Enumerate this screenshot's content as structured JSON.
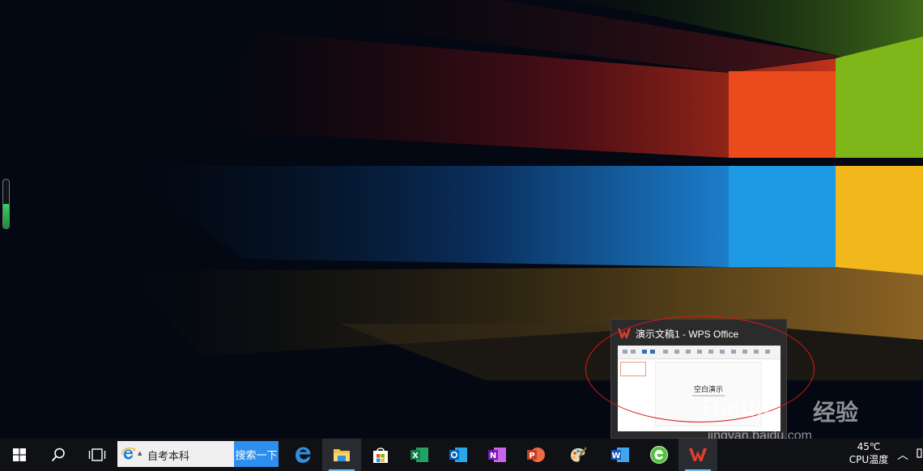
{
  "preview": {
    "title": "演示文稿1 - WPS Office",
    "canvas_title": "空白演示"
  },
  "taskbar": {
    "search_text": "自考本科",
    "search_button": "搜索一下",
    "icons": [
      "start-icon",
      "search-icon",
      "task-view-icon",
      "edge-icon",
      "file-explorer-icon",
      "store-icon",
      "excel-icon",
      "outlook-icon",
      "onenote-icon",
      "powerpoint-icon",
      "paint-icon",
      "word-icon",
      "browser-icon",
      "wps-office-icon"
    ]
  },
  "tray": {
    "temp_value": "45℃",
    "temp_label": "CPU温度"
  },
  "watermark": {
    "brand": "Baidu",
    "brand_cn": "经验",
    "url": "jingyan.baidu.com"
  },
  "colors": {
    "taskbar": "#101114",
    "search_button": "#2d8ef0",
    "annotation": "#d81818",
    "active_underline": "#76b9ed"
  }
}
